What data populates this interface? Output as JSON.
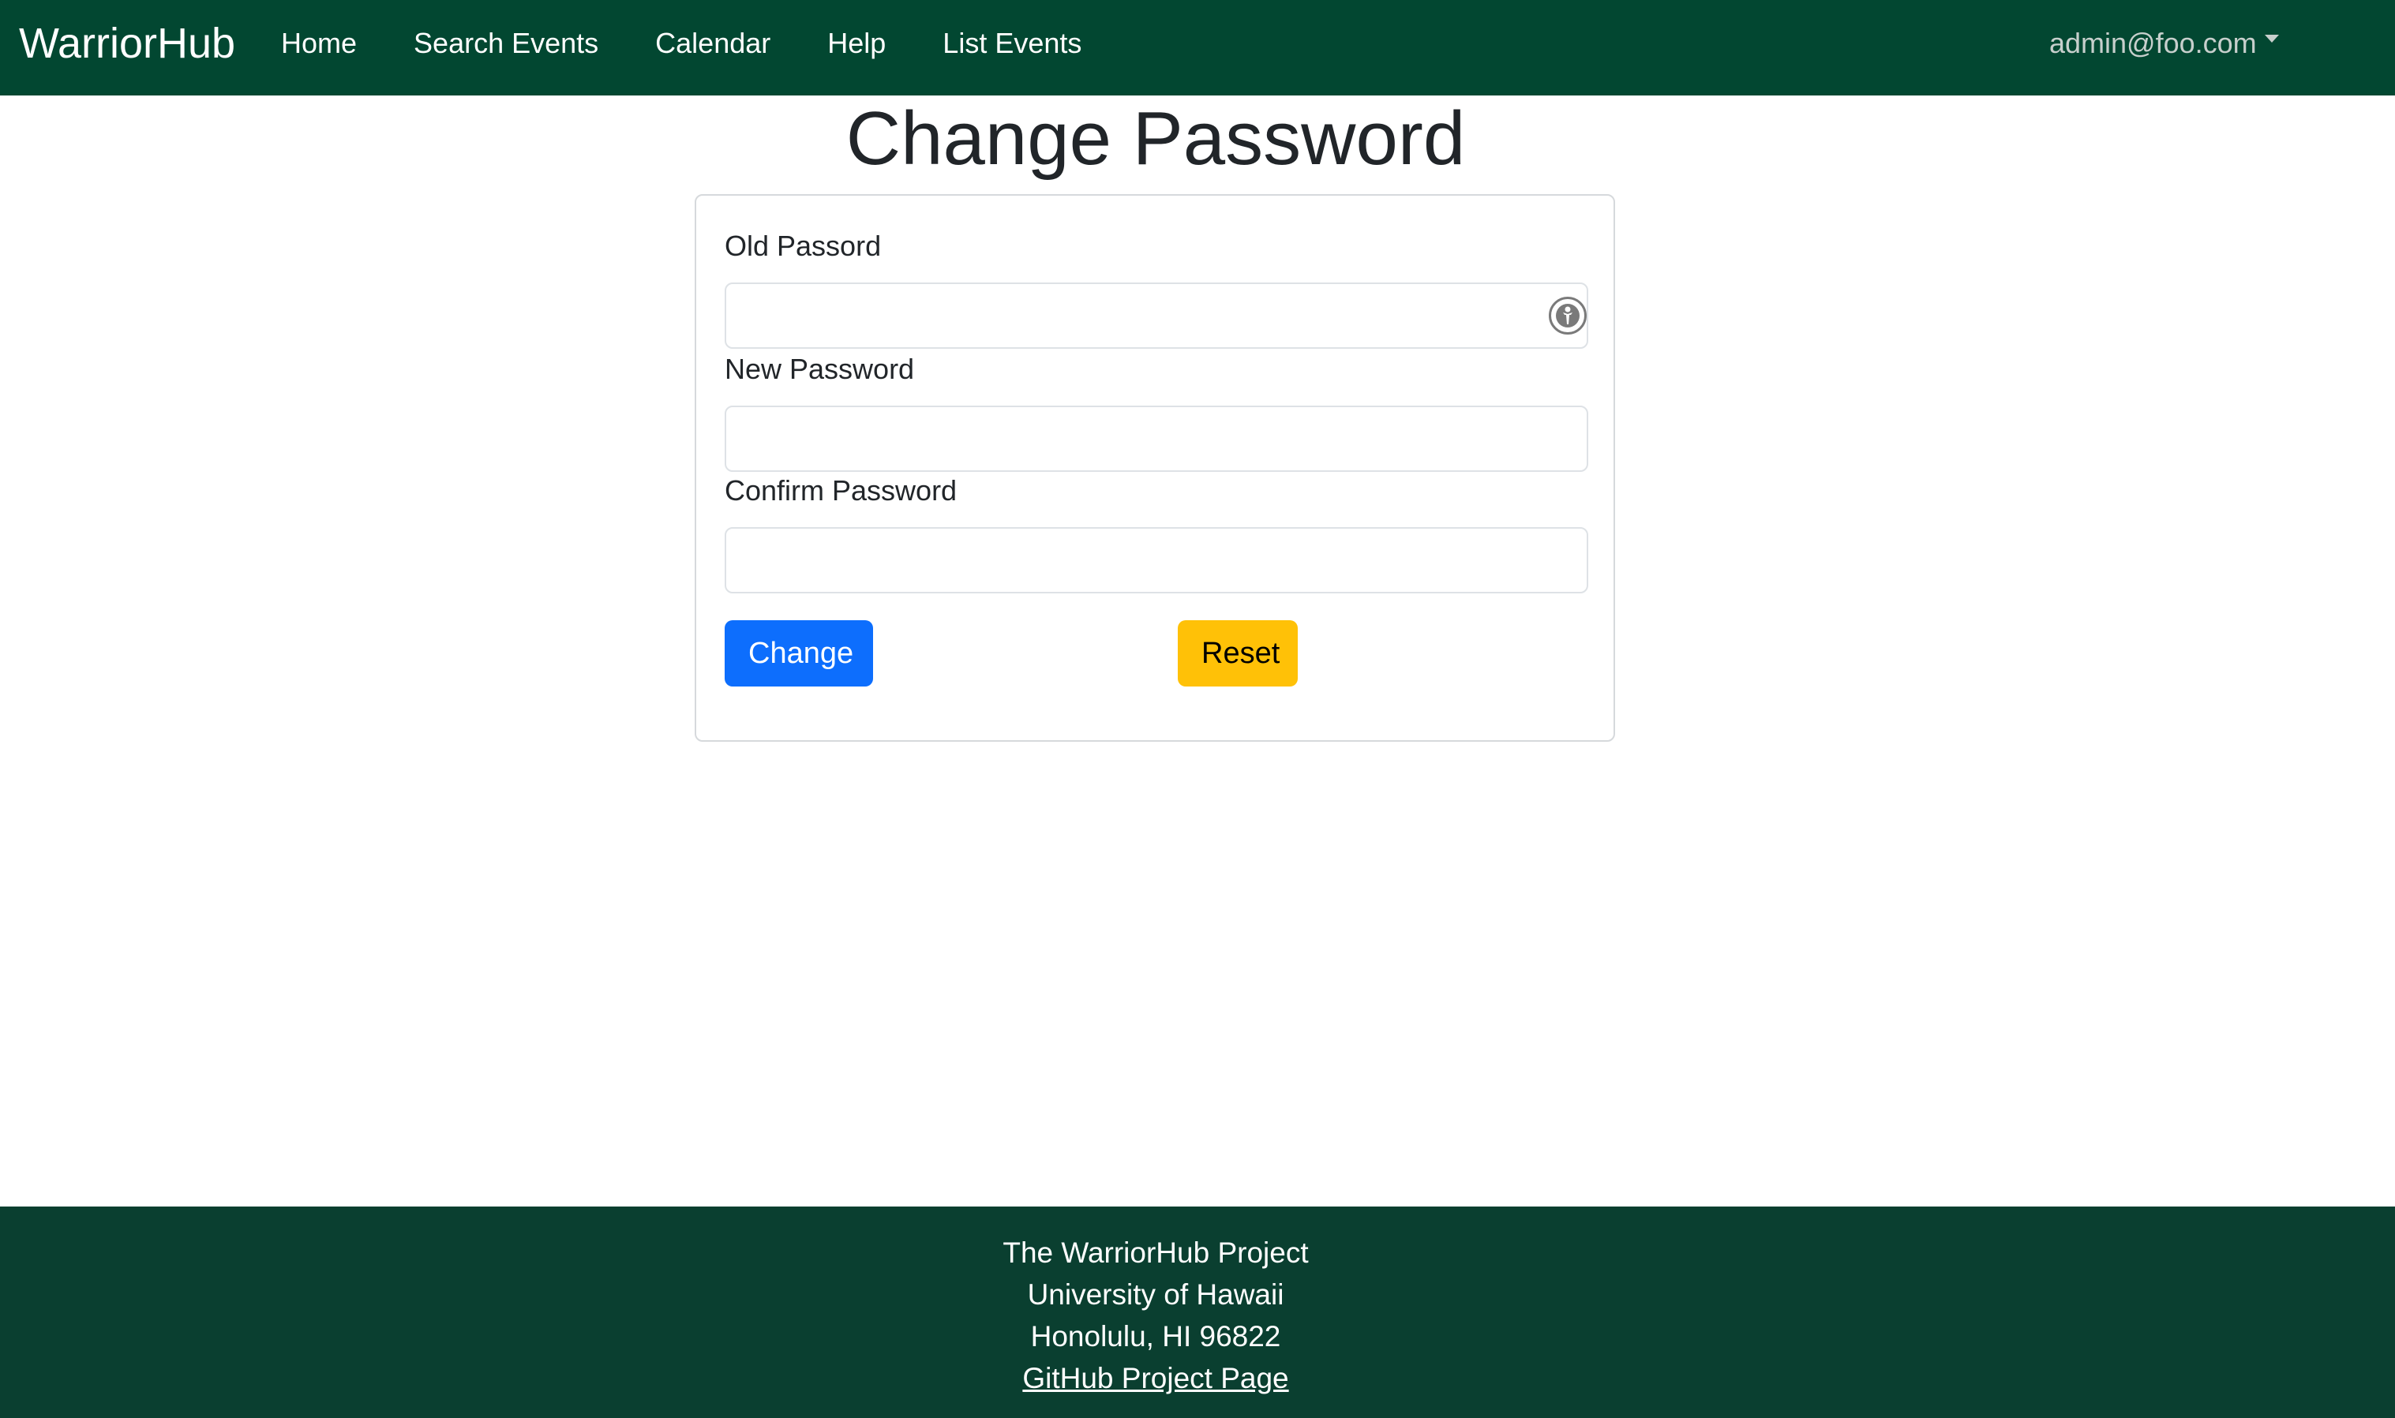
{
  "navbar": {
    "brand": "WarriorHub",
    "links": [
      {
        "label": "Home"
      },
      {
        "label": "Search Events"
      },
      {
        "label": "Calendar"
      },
      {
        "label": "Help"
      },
      {
        "label": "List Events"
      }
    ],
    "user_email": "admin@foo.com"
  },
  "page": {
    "title": "Change Password"
  },
  "form": {
    "old_password": {
      "label": "Old Passord",
      "value": "",
      "placeholder": ""
    },
    "new_password": {
      "label": "New Password",
      "value": "",
      "placeholder": ""
    },
    "confirm_password": {
      "label": "Confirm Password",
      "value": "",
      "placeholder": ""
    },
    "change_button": "Change",
    "reset_button": "Reset",
    "password_manager_icon": "password-manager-icon"
  },
  "footer": {
    "line1": "The WarriorHub Project",
    "line2": "University of Hawaii",
    "line3": "Honolulu, HI 96822",
    "link": "GitHub Project Page"
  },
  "colors": {
    "navbar_bg": "#024731",
    "footer_bg": "#0a3f30",
    "primary": "#0d6efd",
    "warning": "#ffc107"
  }
}
